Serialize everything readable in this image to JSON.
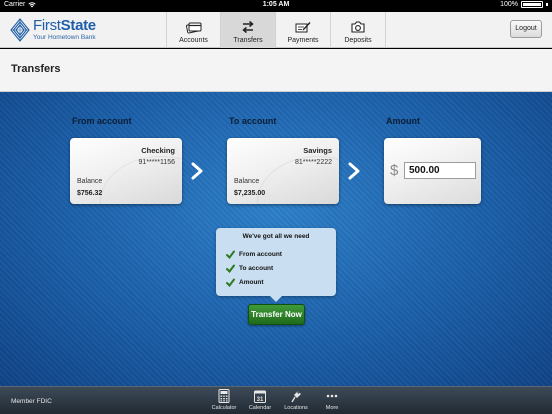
{
  "status_bar": {
    "carrier": "Carrier",
    "time": "1:05 AM",
    "battery": "100%"
  },
  "header": {
    "brand_name_part1": "First",
    "brand_name_part2": "State",
    "brand_tagline": "Your Hometown Bank",
    "nav": [
      {
        "label": "Accounts",
        "icon": "accounts-card-icon",
        "active": false
      },
      {
        "label": "Transfers",
        "icon": "transfer-arrows-icon",
        "active": true
      },
      {
        "label": "Payments",
        "icon": "payments-pen-icon",
        "active": false
      },
      {
        "label": "Deposits",
        "icon": "camera-icon",
        "active": false
      }
    ],
    "logout_label": "Logout"
  },
  "page_title": "Transfers",
  "transfer": {
    "from_label": "From account",
    "to_label": "To account",
    "amount_label": "Amount",
    "from_account": {
      "name": "Checking",
      "number": "91*****1156",
      "balance_label": "Balance",
      "balance": "$756.32"
    },
    "to_account": {
      "name": "Savings",
      "number": "81*****2222",
      "balance_label": "Balance",
      "balance": "$7,235.00"
    },
    "currency_symbol": "$",
    "amount_value": "500.00"
  },
  "checklist": {
    "title": "We've got all we need",
    "items": [
      "From account",
      "To account",
      "Amount"
    ]
  },
  "transfer_button_label": "Transfer Now",
  "footer": {
    "member_text": "Member FDIC",
    "calendar_day": "31",
    "nav": [
      {
        "label": "Calculator",
        "icon": "calculator-icon"
      },
      {
        "label": "Calendar",
        "icon": "calendar-icon"
      },
      {
        "label": "Locations",
        "icon": "location-pin-icon"
      },
      {
        "label": "More",
        "icon": "more-dots-icon"
      }
    ]
  },
  "colors": {
    "brand_blue": "#1f5fa8",
    "background_blue": "#1a5ea8",
    "button_green": "#2f8a2b",
    "checkmark_green": "#2c7a1f"
  }
}
